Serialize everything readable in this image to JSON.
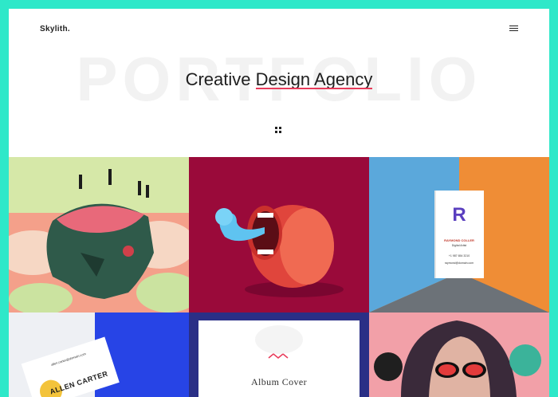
{
  "header": {
    "brand": "Skylith."
  },
  "hero": {
    "bg_word": "PORTFOLIO",
    "title_part1": "Creative ",
    "title_part2": "Design Agency"
  },
  "accent": "#e83b5a",
  "frame_color": "#2ee8c9",
  "card": {
    "initial": "R",
    "name": "RAYMOND COLLER",
    "role": "Digital Artist",
    "phone": "+1 987 654 3210",
    "email": "raymond@domain.com"
  },
  "cards_bottom": {
    "name": "ALLEN CARTER",
    "email": "allen.carter@domain.com"
  },
  "album": {
    "label": "Album Cover"
  },
  "icons": {
    "menu": "hamburger-icon",
    "grid": "grid-icon"
  }
}
